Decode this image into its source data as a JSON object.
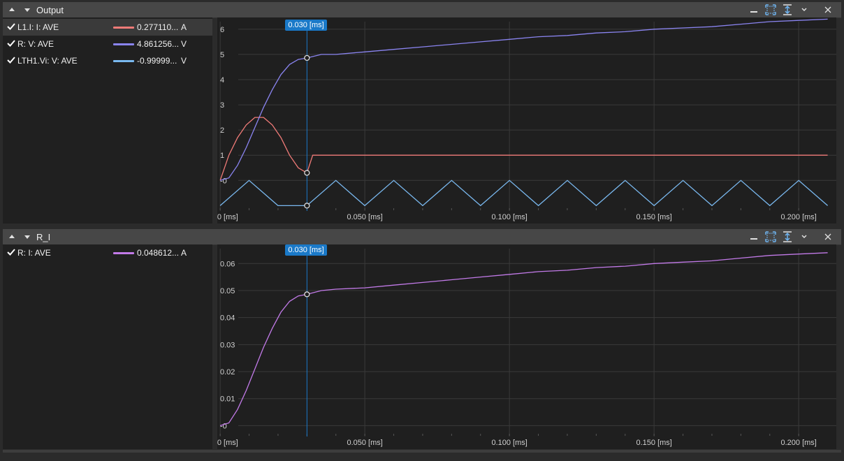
{
  "panels": [
    {
      "title": "Output",
      "legend": [
        {
          "name": "L1.I: I: AVE",
          "value": "0.277110...",
          "unit": "A",
          "color": "#f07b78",
          "checked": true,
          "selected": true
        },
        {
          "name": "R: V: AVE",
          "value": "4.861256...",
          "unit": "V",
          "color": "#8a84f0",
          "checked": true,
          "selected": false
        },
        {
          "name": "LTH1.Vi: V: AVE",
          "value": "-0.99999...",
          "unit": "V",
          "color": "#7ab9f0",
          "checked": true,
          "selected": false
        }
      ],
      "cursor_label": "0.030 [ms]"
    },
    {
      "title": "R_I",
      "legend": [
        {
          "name": "R: I: AVE",
          "value": "0.048612...",
          "unit": "A",
          "color": "#c27ae8",
          "checked": true,
          "selected": false
        }
      ],
      "cursor_label": "0.030 [ms]"
    }
  ],
  "toolbar_icons": [
    "minimize-icon",
    "fit-view-icon",
    "fit-vertical-icon",
    "chevron-down-icon",
    "close-icon"
  ],
  "chart_data": [
    {
      "type": "line",
      "title": "",
      "xlabel": "",
      "ylabel": "",
      "x_ticks": [
        "0.000 [ms]",
        "0.050 [ms]",
        "0.100 [ms]",
        "0.150 [ms]",
        "0.200 [ms]"
      ],
      "y_ticks": [
        "6",
        "5",
        "4",
        "3",
        "2",
        "1",
        "-0"
      ],
      "xlim": [
        -0.001,
        0.213
      ],
      "ylim": [
        -1.1,
        6.3
      ],
      "cursor_x": 0.03,
      "series": [
        {
          "name": "L1.I: I: AVE",
          "color": "#f07b78",
          "x": [
            0,
            0.003,
            0.006,
            0.009,
            0.012,
            0.015,
            0.018,
            0.021,
            0.024,
            0.027,
            0.03,
            0.032,
            0.04,
            0.05,
            0.06,
            0.07,
            0.08,
            0.09,
            0.1,
            0.11,
            0.12,
            0.13,
            0.14,
            0.15,
            0.16,
            0.17,
            0.18,
            0.19,
            0.2,
            0.21
          ],
          "y": [
            0,
            1.0,
            1.7,
            2.2,
            2.5,
            2.5,
            2.2,
            1.7,
            1.0,
            0.5,
            0.3,
            1.0,
            1.0,
            1.0,
            1.0,
            1.0,
            1.0,
            1.0,
            1.0,
            1.0,
            1.0,
            1.0,
            1.0,
            1.0,
            1.0,
            1.0,
            1.0,
            1.0,
            1.0,
            1.0
          ]
        },
        {
          "name": "R: V: AVE",
          "color": "#8a84f0",
          "x": [
            0,
            0.003,
            0.006,
            0.009,
            0.012,
            0.015,
            0.018,
            0.021,
            0.024,
            0.027,
            0.03,
            0.035,
            0.04,
            0.05,
            0.06,
            0.07,
            0.08,
            0.09,
            0.1,
            0.11,
            0.12,
            0.13,
            0.14,
            0.15,
            0.16,
            0.17,
            0.18,
            0.19,
            0.2,
            0.21
          ],
          "y": [
            0,
            0.1,
            0.6,
            1.3,
            2.1,
            2.9,
            3.6,
            4.2,
            4.6,
            4.8,
            4.86,
            5.0,
            5.0,
            5.1,
            5.2,
            5.3,
            5.4,
            5.5,
            5.6,
            5.7,
            5.75,
            5.85,
            5.9,
            6.0,
            6.05,
            6.1,
            6.2,
            6.3,
            6.35,
            6.4
          ]
        },
        {
          "name": "LTH1.Vi: V: AVE",
          "color": "#7ab9f0",
          "x": [
            0,
            0.01,
            0.02,
            0.03,
            0.04,
            0.05,
            0.06,
            0.07,
            0.08,
            0.09,
            0.1,
            0.11,
            0.12,
            0.13,
            0.14,
            0.15,
            0.16,
            0.17,
            0.18,
            0.19,
            0.2,
            0.21
          ],
          "y": [
            -1.0,
            0,
            -1.0,
            -1.0,
            0,
            -1.0,
            0,
            -1.0,
            0,
            -1.0,
            0,
            -1.0,
            0,
            -1.0,
            0,
            -1.0,
            0,
            -1.0,
            0,
            -1.0,
            0,
            -1.0
          ]
        }
      ]
    },
    {
      "type": "line",
      "title": "",
      "xlabel": "",
      "ylabel": "",
      "x_ticks": [
        "0.000 [ms]",
        "0.050 [ms]",
        "0.100 [ms]",
        "0.150 [ms]",
        "0.200 [ms]"
      ],
      "y_ticks": [
        "0.06",
        "0.05",
        "0.04",
        "0.03",
        "0.02",
        "0.01",
        "-0"
      ],
      "xlim": [
        -0.001,
        0.213
      ],
      "ylim": [
        -0.003,
        0.0655
      ],
      "cursor_x": 0.03,
      "series": [
        {
          "name": "R: I: AVE",
          "color": "#c27ae8",
          "x": [
            0,
            0.003,
            0.006,
            0.009,
            0.012,
            0.015,
            0.018,
            0.021,
            0.024,
            0.027,
            0.03,
            0.035,
            0.04,
            0.05,
            0.06,
            0.07,
            0.08,
            0.09,
            0.1,
            0.11,
            0.12,
            0.13,
            0.14,
            0.15,
            0.16,
            0.17,
            0.18,
            0.19,
            0.2,
            0.21
          ],
          "y": [
            0,
            0.001,
            0.006,
            0.013,
            0.021,
            0.029,
            0.036,
            0.042,
            0.046,
            0.048,
            0.0486,
            0.05,
            0.0505,
            0.051,
            0.052,
            0.053,
            0.054,
            0.055,
            0.056,
            0.057,
            0.0575,
            0.0585,
            0.059,
            0.06,
            0.0605,
            0.061,
            0.062,
            0.063,
            0.0635,
            0.064
          ]
        }
      ]
    }
  ]
}
